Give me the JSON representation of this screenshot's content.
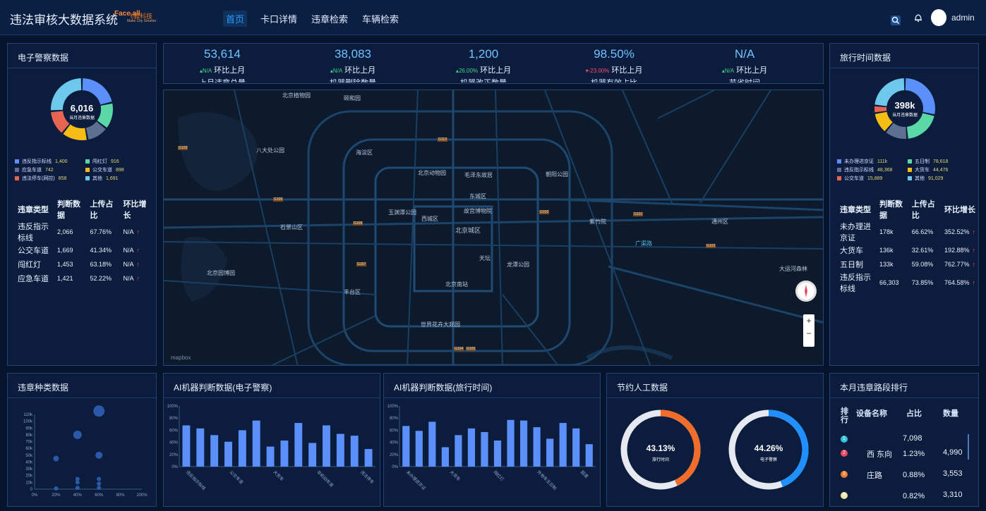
{
  "header": {
    "title": "违法审核大数据系统",
    "logo_mark": "Face all",
    "logo_text": "飞狐科技",
    "logo_sub": "Make City Smarter",
    "nav": [
      "首页",
      "卡口详情",
      "违章检索",
      "车辆检索"
    ],
    "active_nav": "首页",
    "user": "admin"
  },
  "kpis": [
    {
      "value": "53,614",
      "delta": "N/A",
      "delta_dir": "up",
      "compare": "环比上月",
      "label": "上月违章总量"
    },
    {
      "value": "38,083",
      "delta": "N/A",
      "delta_dir": "up",
      "compare": "环比上月",
      "label": "机器删除数量"
    },
    {
      "value": "1,200",
      "delta": "26.00%",
      "delta_dir": "up",
      "compare": "环比上月",
      "label": "机器改正数量"
    },
    {
      "value": "98.50%",
      "delta": "-23.00%",
      "delta_dir": "down",
      "compare": "环比上月",
      "label": "机器有效占比"
    },
    {
      "value": "N/A",
      "delta": "N/A",
      "delta_dir": "up",
      "compare": "环比上月",
      "label": "节省时间"
    }
  ],
  "left_panel": {
    "title": "电子警察数据",
    "donut_value": "6,016",
    "donut_label": "当月违章数据",
    "colors": [
      "#5b8ff9",
      "#5ad8a6",
      "#5d7092",
      "#f6bd16",
      "#e86452",
      "#6dc8ec"
    ],
    "legend": [
      {
        "name": "违反指示标线",
        "value": "1,400"
      },
      {
        "name": "闯红灯",
        "value": "916"
      },
      {
        "name": "应急车道",
        "value": "742"
      },
      {
        "name": "公交车道",
        "value": "898"
      },
      {
        "name": "违法停车(网控)",
        "value": "858"
      },
      {
        "name": "其他",
        "value": "1,691"
      }
    ],
    "table": {
      "headers": [
        "违章类型",
        "判断数据",
        "上传占比",
        "环比增长"
      ],
      "rows": [
        [
          "违反指示标线",
          "2,066",
          "67.76%",
          "N/A"
        ],
        [
          "公交车道",
          "1,669",
          "41.34%",
          "N/A"
        ],
        [
          "闯红灯",
          "1,453",
          "63.18%",
          "N/A"
        ],
        [
          "应急车道",
          "1,421",
          "52.22%",
          "N/A"
        ]
      ]
    }
  },
  "right_panel": {
    "title": "旅行时间数据",
    "donut_value": "398k",
    "donut_label": "当月违章数据",
    "colors": [
      "#5b8ff9",
      "#5ad8a6",
      "#5d7092",
      "#f6bd16",
      "#e86452",
      "#6dc8ec"
    ],
    "legend": [
      {
        "name": "未办理进京证",
        "value": "111k"
      },
      {
        "name": "五日制",
        "value": "78,618"
      },
      {
        "name": "违反指示标线",
        "value": "48,368"
      },
      {
        "name": "大货车",
        "value": "44,476"
      },
      {
        "name": "公交车道",
        "value": "15,889"
      },
      {
        "name": "其他",
        "value": "91,029"
      }
    ],
    "table": {
      "headers": [
        "违章类型",
        "判断数据",
        "上传占比",
        "环比增长"
      ],
      "rows": [
        [
          "未办理进京证",
          "178k",
          "66.62%",
          "352.52%"
        ],
        [
          "大货车",
          "136k",
          "32.61%",
          "192.88%"
        ],
        [
          "五日制",
          "133k",
          "59.08%",
          "762.77%"
        ],
        [
          "违反指示标线",
          "66,303",
          "73.85%",
          "764.58%"
        ]
      ]
    }
  },
  "map": {
    "attribution": "mapbox",
    "labels": [
      "北京植物园",
      "颐和园",
      "八大处公园",
      "海淀区",
      "北京动物园",
      "毛泽东故居",
      "东城区",
      "朝阳公园",
      "西城区",
      "故宫博物院",
      "北京城区",
      "紫竹院",
      "石景山区",
      "玉渊潭公园",
      "天坛",
      "龙潭公园",
      "丰台区",
      "北京园博园",
      "世界花卉大观园",
      "北京南站",
      "通州区",
      "广渠路",
      "大运河森林"
    ],
    "shields": [
      "G109",
      "G110",
      "G108",
      "G106",
      "G107",
      "G103",
      "G101",
      "G102",
      "G104",
      "G105"
    ]
  },
  "panels": {
    "violation_types": "违章种类数据",
    "ai_police": "AI机器判断数据(电子警察)",
    "ai_travel": "AI机器判断数据(旅行时间)",
    "labor": "节约人工数据",
    "ranking": "本月违章路段排行"
  },
  "chart_data": [
    {
      "type": "scatter",
      "title": "违章种类数据",
      "x_ticks": [
        "0%",
        "20%",
        "40%",
        "60%",
        "80%",
        "100%"
      ],
      "y_ticks": [
        "0",
        "10k",
        "20k",
        "30k",
        "40k",
        "50k",
        "60k",
        "70k",
        "80k",
        "90k",
        "100k",
        "110k"
      ],
      "xlim": [
        0,
        100
      ],
      "ylim": [
        0,
        110000
      ],
      "points": [
        {
          "x": 20,
          "y": 45000,
          "r": 4
        },
        {
          "x": 20,
          "y": 1000,
          "r": 3
        },
        {
          "x": 40,
          "y": 80000,
          "r": 6
        },
        {
          "x": 40,
          "y": 15000,
          "r": 3
        },
        {
          "x": 40,
          "y": 10000,
          "r": 3
        },
        {
          "x": 40,
          "y": 2000,
          "r": 3
        },
        {
          "x": 60,
          "y": 115000,
          "r": 8
        },
        {
          "x": 60,
          "y": 50000,
          "r": 5
        },
        {
          "x": 60,
          "y": 15000,
          "r": 3
        },
        {
          "x": 60,
          "y": 8000,
          "r": 3
        },
        {
          "x": 60,
          "y": 2000,
          "r": 3
        }
      ]
    },
    {
      "type": "bar",
      "title": "AI机器判断数据(电子警察)",
      "categories": [
        "违反指示标线",
        "",
        "公交车道",
        "",
        "大货车",
        "",
        "非机动车道",
        "",
        "违法停车"
      ],
      "values": [
        68,
        63,
        52,
        41,
        60,
        76,
        33,
        43,
        72,
        39,
        68,
        54,
        51,
        29
      ],
      "y_ticks": [
        "0%",
        "20%",
        "40%",
        "60%",
        "80%",
        "100%"
      ],
      "ylim": [
        0,
        100
      ]
    },
    {
      "type": "bar",
      "title": "AI机器判断数据(旅行时间)",
      "categories": [
        "未办理进京证",
        "",
        "大货车",
        "",
        "闯红灯",
        "",
        "外地车五日制",
        "",
        "超速"
      ],
      "values": [
        67,
        59,
        74,
        32,
        52,
        63,
        57,
        43,
        77,
        76,
        65,
        46,
        72,
        63,
        37
      ],
      "y_ticks": [
        "0%",
        "20%",
        "40%",
        "60%",
        "80%",
        "100%"
      ],
      "ylim": [
        0,
        100
      ]
    }
  ],
  "labor": {
    "gauges": [
      {
        "value": 43.13,
        "text": "43.13%",
        "label": "旅行时间",
        "color": "#f06c2b"
      },
      {
        "value": 44.26,
        "text": "44.26%",
        "label": "电子警察",
        "color": "#1e90ff"
      }
    ]
  },
  "ranking": {
    "headers": [
      "排行",
      "设备名称",
      "占比",
      "数量"
    ],
    "rows": [
      {
        "rank": "1",
        "name": "",
        "share": "",
        "count": "7,098",
        "color": "#35c3d9"
      },
      {
        "rank": "2",
        "name": "西 东向",
        "share": "1.23%",
        "count": "4,990",
        "color": "#e8485f"
      },
      {
        "rank": "3",
        "name": "庄路",
        "share": "0.88%",
        "count": "3,553",
        "color": "#f07c32"
      },
      {
        "rank": "4",
        "name": "",
        "share": "0.82%",
        "count": "3,310",
        "color": "#f3e5a8"
      }
    ]
  }
}
